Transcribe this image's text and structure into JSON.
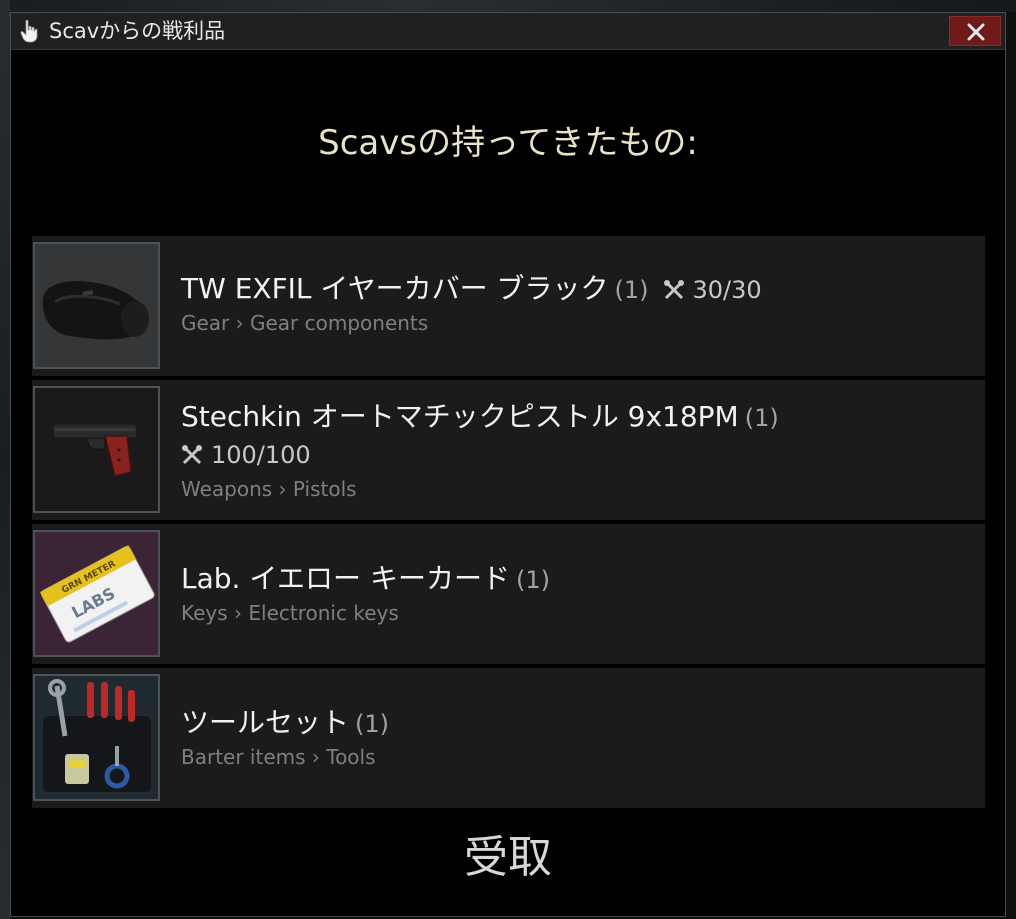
{
  "window": {
    "title": "Scavからの戦利品",
    "close_label": "✕"
  },
  "heading": "Scavsの持ってきたもの:",
  "items": [
    {
      "name": "TW EXFIL イヤーカバー ブラック",
      "quantity": "(1)",
      "durability": "30/30",
      "category": "Gear › Gear components",
      "icon": "ear-covers-icon"
    },
    {
      "name": "Stechkin オートマチックピストル 9x18PM",
      "quantity": "(1)",
      "durability": "100/100",
      "category": "Weapons › Pistols",
      "icon": "pistol-icon"
    },
    {
      "name": "Lab. イエロー キーカード",
      "quantity": "(1)",
      "durability": "",
      "category": "Keys › Electronic keys",
      "icon": "keycard-icon",
      "card_text": "LABS",
      "card_stripe_text": "GRN METER"
    },
    {
      "name": "ツールセット",
      "quantity": "(1)",
      "durability": "",
      "category": "Barter items › Tools",
      "icon": "toolset-icon"
    }
  ],
  "receive_label": "受取",
  "colors": {
    "heading": "#e7e3c6",
    "close_bg": "#6e1a1a",
    "row_bg": "#1b1b1b",
    "category": "#7c8084",
    "keycard_bg": "#3a2436"
  }
}
